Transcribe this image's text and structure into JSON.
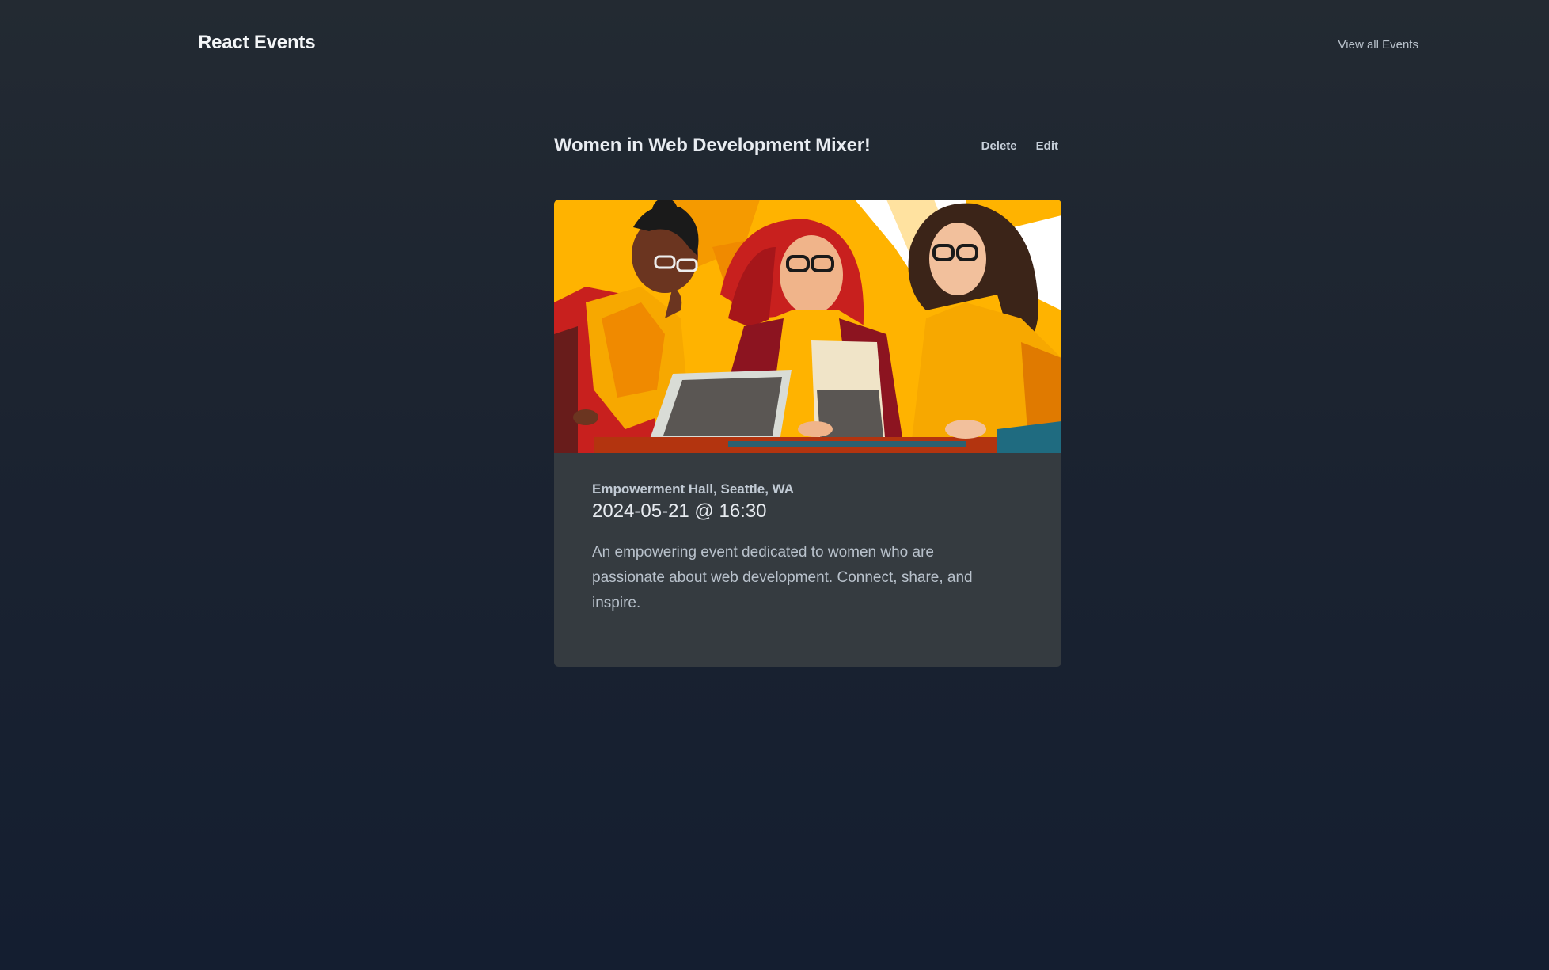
{
  "header": {
    "brand": "React Events",
    "nav_link": "View all Events"
  },
  "event": {
    "title": "Women in Web Development Mixer!",
    "actions": {
      "delete_label": "Delete",
      "edit_label": "Edit"
    },
    "image_alt": "Illustration of three women working on laptops",
    "location": "Empowerment Hall, Seattle, WA",
    "datetime": "2024-05-21 @ 16:30",
    "description": "An empowering event dedicated to women who are passionate about web development. Connect, share, and inspire."
  },
  "colors": {
    "background_top": "#232a32",
    "background_bottom": "#141e30",
    "card": "#353b40",
    "illustration_yellow": "#ffb300",
    "illustration_orange": "#f08a00",
    "illustration_red": "#c8201e"
  }
}
